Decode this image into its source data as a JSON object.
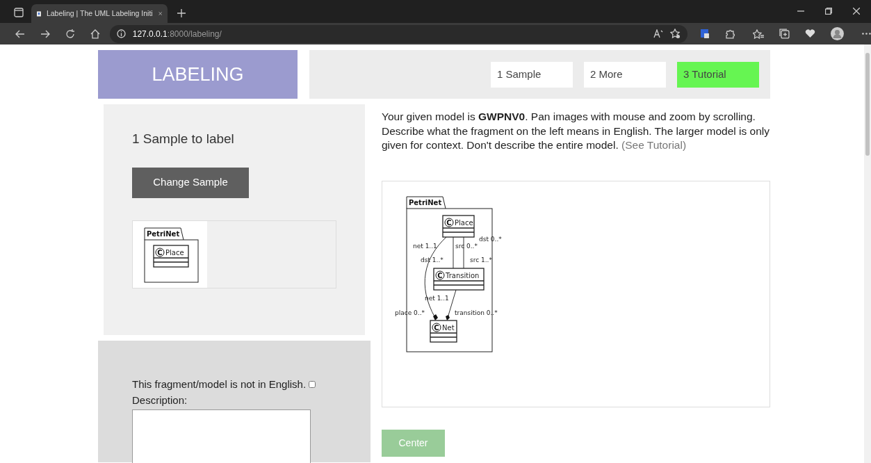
{
  "browser": {
    "tab_title": "Labeling | The UML Labeling Initi",
    "url_host": "127.0.0.1",
    "url_path": ":8000/labeling/"
  },
  "header": {
    "logo": "LABELING",
    "nav": [
      {
        "label": "1 Sample",
        "selected": false
      },
      {
        "label": "2 More",
        "selected": false
      },
      {
        "label": "3 Tutorial",
        "selected": true
      }
    ]
  },
  "sample_panel": {
    "title": "1 Sample to label",
    "button": "Change Sample",
    "fragment": {
      "package": "PetriNet",
      "classes": [
        {
          "marker": "C",
          "name": "Place"
        }
      ]
    }
  },
  "form": {
    "not_english_label": "This fragment/model is not in English.",
    "not_english_checked": false,
    "description_label": "Description:"
  },
  "instructions": "Your given model is **GWPNV0**. Pan images with mouse and zoom by scrolling. Describe what the fragment on the left means in English. The larger model is only given for context. Don't describe the entire model.",
  "tutorial_link": "(See Tutorial)",
  "model": {
    "package": "PetriNet",
    "classes": [
      {
        "marker": "C",
        "name": "Place"
      },
      {
        "marker": "C",
        "name": "Transition"
      },
      {
        "marker": "C",
        "name": "Net"
      }
    ],
    "edge_labels": [
      "dst 0..*",
      "net 1..1",
      "src 0..*",
      "dst 1..*",
      "src 1..*",
      "net 1..1",
      "place 0..*",
      "transition 0..*"
    ]
  },
  "center_button": "Center"
}
